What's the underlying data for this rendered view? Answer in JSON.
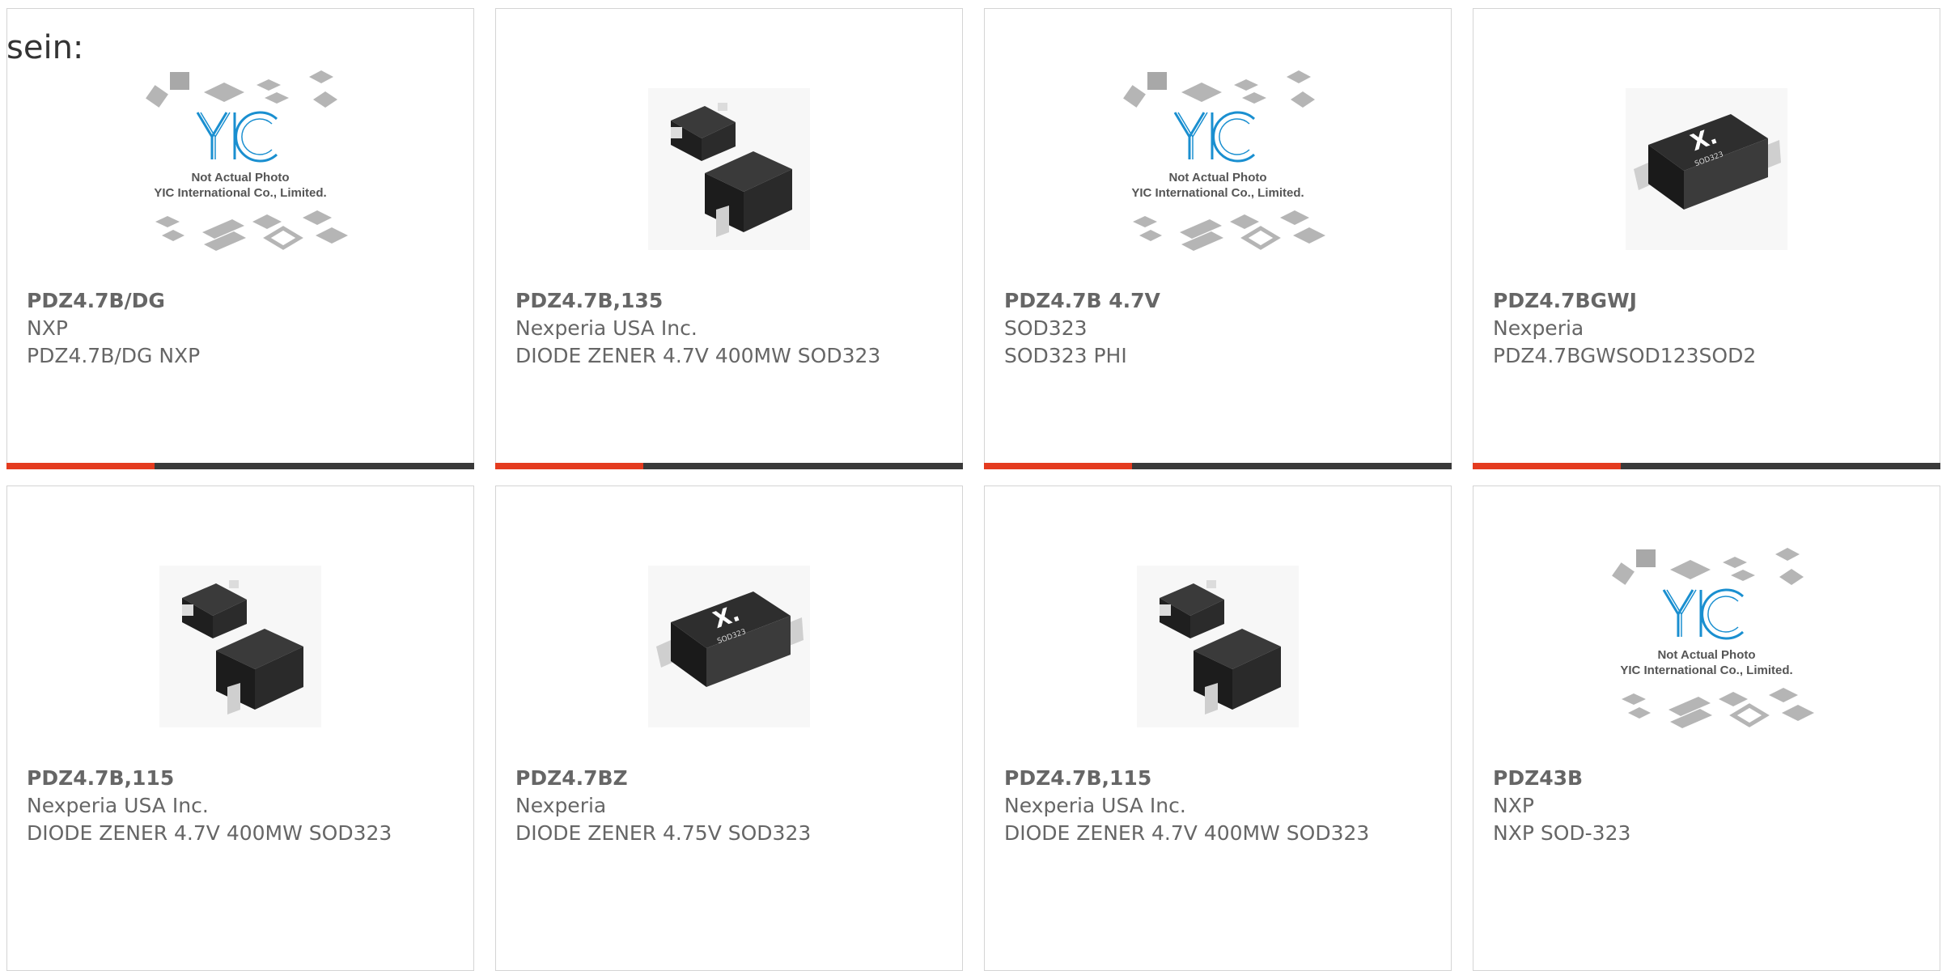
{
  "intro_text": "sein:",
  "placeholder": {
    "brand": "YIC",
    "line1": "Not Actual Photo",
    "line2": "YIC International Co., Limited."
  },
  "package_label": "SOD323",
  "colors": {
    "accent": "#e43b1f",
    "bar_dark": "#3a3a3a",
    "text": "#666666",
    "brand_blue": "#1a8fd0"
  },
  "products": [
    {
      "image": "placeholder",
      "part_number": "PDZ4.7B/DG",
      "manufacturer": "NXP",
      "description": "PDZ4.7B/DG NXP"
    },
    {
      "image": "diode-pair",
      "part_number": "PDZ4.7B,135",
      "manufacturer": "Nexperia USA Inc.",
      "description": "DIODE ZENER 4.7V 400MW SOD323"
    },
    {
      "image": "placeholder",
      "part_number": "PDZ4.7B 4.7V",
      "manufacturer": "SOD323",
      "description": "SOD323 PHI"
    },
    {
      "image": "nexperia-package",
      "part_number": "PDZ4.7BGWJ",
      "manufacturer": "Nexperia",
      "description": "PDZ4.7BGWSOD123SOD2"
    },
    {
      "image": "diode-pair",
      "part_number": "PDZ4.7B,115",
      "manufacturer": "Nexperia USA Inc.",
      "description": "DIODE ZENER 4.7V 400MW SOD323"
    },
    {
      "image": "nexperia-package",
      "part_number": "PDZ4.7BZ",
      "manufacturer": "Nexperia",
      "description": "DIODE ZENER 4.75V SOD323"
    },
    {
      "image": "diode-pair",
      "part_number": "PDZ4.7B,115",
      "manufacturer": "Nexperia USA Inc.",
      "description": "DIODE ZENER 4.7V 400MW SOD323"
    },
    {
      "image": "placeholder",
      "part_number": "PDZ43B",
      "manufacturer": "NXP",
      "description": "NXP SOD-323"
    }
  ]
}
